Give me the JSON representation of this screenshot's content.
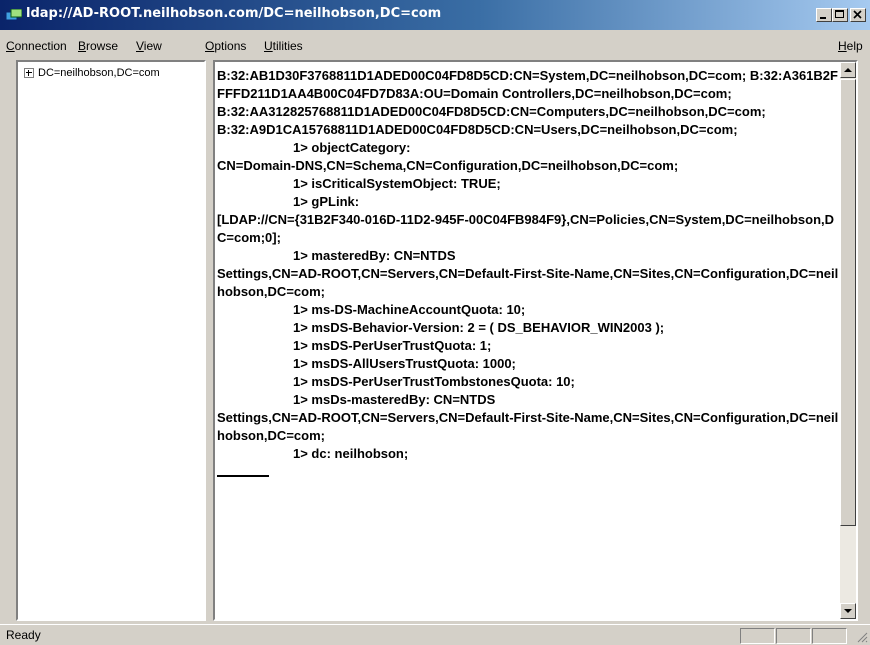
{
  "window": {
    "title": "ldap://AD-ROOT.neilhobson.com/DC=neilhobson,DC=com",
    "icon": "ldp-app-icon",
    "controls": [
      "minimize",
      "maximize",
      "close"
    ]
  },
  "menu": {
    "items": [
      "Connection",
      "Browse",
      "View",
      "Options",
      "Utilities"
    ],
    "help": "Help"
  },
  "tree": {
    "root": "DC=neilhobson,DC=com"
  },
  "detail": {
    "lines": [
      "B:32:AB1D30F3768811D1ADED00C04FD8D5CD:CN=System,DC=neilhobson,DC=com; B:32:A361B2FFFFD211D1AA4B00C04FD7D83A:OU=Domain Controllers,DC=neilhobson,DC=com;",
      "B:32:AA312825768811D1ADED00C04FD8D5CD:CN=Computers,DC=neilhobson,DC=com;",
      "B:32:A9D1CA15768811D1ADED00C04FD8D5CD:CN=Users,DC=neilhobson,DC=com;",
      "1> objectCategory:",
      "CN=Domain-DNS,CN=Schema,CN=Configuration,DC=neilhobson,DC=com;",
      "1> isCriticalSystemObject: TRUE;",
      "1> gPLink:",
      "[LDAP://CN={31B2F340-016D-11D2-945F-00C04FB984F9},CN=Policies,CN=System,DC=neilhobson,DC=com;0];",
      "1> masteredBy: CN=NTDS",
      "Settings,CN=AD-ROOT,CN=Servers,CN=Default-First-Site-Name,CN=Sites,CN=Configuration,DC=neilhobson,DC=com;",
      "1> ms-DS-MachineAccountQuota: 10;",
      "1> msDS-Behavior-Version: 2 = ( DS_BEHAVIOR_WIN2003 );",
      "1> msDS-PerUserTrustQuota: 1;",
      "1> msDS-AllUsersTrustQuota: 1000;",
      "1> msDS-PerUserTrustTombstonesQuota: 10;",
      "1> msDs-masteredBy: CN=NTDS",
      "Settings,CN=AD-ROOT,CN=Servers,CN=Default-First-Site-Name,CN=Sites,CN=Configuration,DC=neilhobson,DC=com;",
      "1> dc: neilhobson;"
    ]
  },
  "status": {
    "text": "Ready"
  }
}
